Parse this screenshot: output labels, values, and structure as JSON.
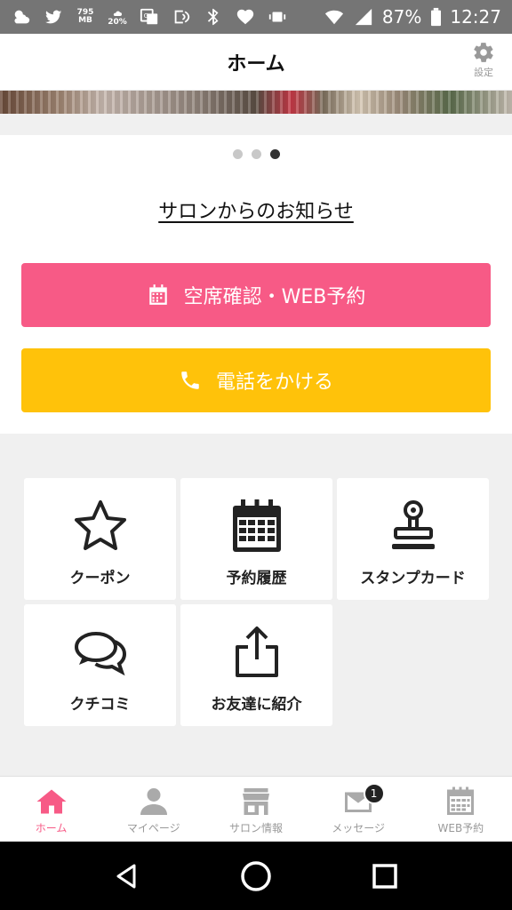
{
  "status_bar": {
    "data_label_top": "795",
    "data_label_bottom": "MB",
    "weather_percent": "20%",
    "battery": "87%",
    "time": "12:27"
  },
  "header": {
    "title": "ホーム",
    "settings_label": "設定"
  },
  "carousel": {
    "dots": 3,
    "active_index": 2
  },
  "notice_link": "サロンからのお知らせ",
  "buttons": {
    "reserve_label": "空席確認・WEB予約",
    "call_label": "電話をかける"
  },
  "tiles": [
    {
      "label": "クーポン",
      "icon": "star-icon"
    },
    {
      "label": "予約履歴",
      "icon": "calendar-icon"
    },
    {
      "label": "スタンプカード",
      "icon": "stamp-icon"
    },
    {
      "label": "クチコミ",
      "icon": "chat-bubbles-icon"
    },
    {
      "label": "お友達に紹介",
      "icon": "share-icon"
    }
  ],
  "tab_bar": [
    {
      "label": "ホーム",
      "icon": "home-icon",
      "active": true
    },
    {
      "label": "マイページ",
      "icon": "user-icon"
    },
    {
      "label": "サロン情報",
      "icon": "store-icon"
    },
    {
      "label": "メッセージ",
      "icon": "mail-icon",
      "badge": "1"
    },
    {
      "label": "WEB予約",
      "icon": "calendar-icon"
    }
  ],
  "colors": {
    "accent_pink": "#f75a86",
    "accent_yellow": "#ffc20a",
    "status_bar": "#757575"
  }
}
